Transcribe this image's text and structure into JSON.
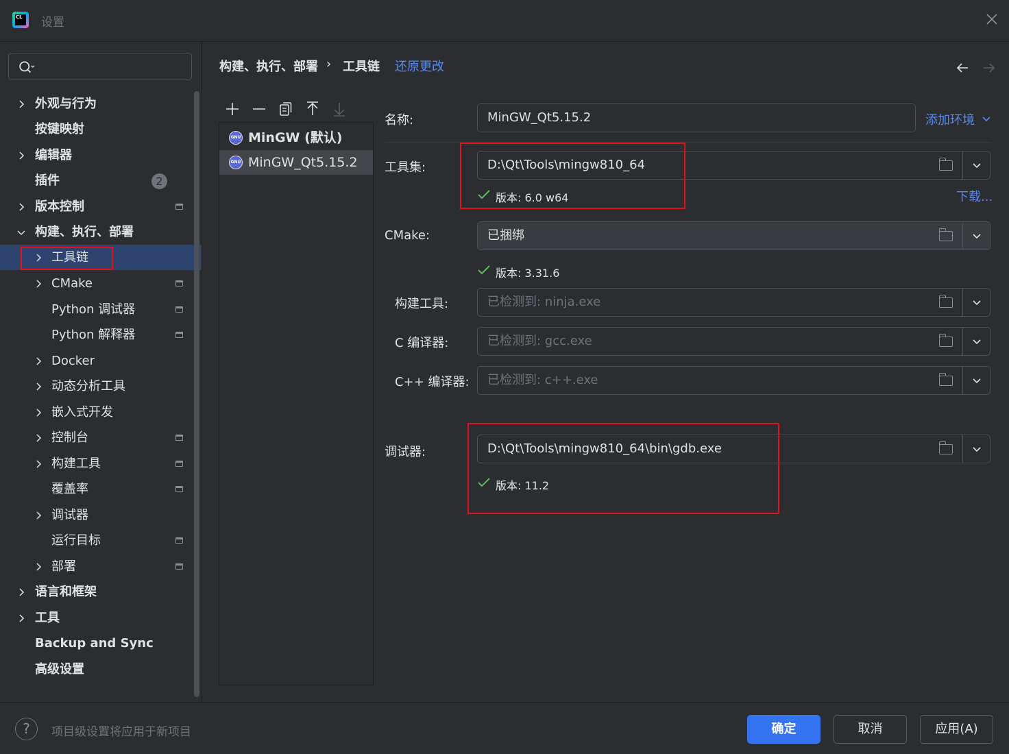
{
  "window": {
    "title": "设置",
    "logo_text": "CL"
  },
  "sidebar": {
    "search_placeholder": "",
    "items": [
      {
        "label": "外观与行为",
        "bold": true
      },
      {
        "label": "按键映射",
        "bold": true
      },
      {
        "label": "编辑器",
        "bold": true
      },
      {
        "label": "插件",
        "bold": true,
        "badge": "2"
      },
      {
        "label": "版本控制",
        "bold": true
      },
      {
        "label": "构建、执行、部署",
        "bold": true
      },
      {
        "label": "工具链"
      },
      {
        "label": "CMake"
      },
      {
        "label": "Python 调试器"
      },
      {
        "label": "Python 解释器"
      },
      {
        "label": "Docker"
      },
      {
        "label": "动态分析工具"
      },
      {
        "label": "嵌入式开发"
      },
      {
        "label": "控制台"
      },
      {
        "label": "构建工具"
      },
      {
        "label": "覆盖率"
      },
      {
        "label": "调试器"
      },
      {
        "label": "运行目标"
      },
      {
        "label": "部署"
      },
      {
        "label": "语言和框架",
        "bold": true
      },
      {
        "label": "工具",
        "bold": true
      },
      {
        "label": "Backup and Sync",
        "bold": true
      },
      {
        "label": "高级设置",
        "bold": true
      }
    ]
  },
  "breadcrumb": {
    "parent": "构建、执行、部署",
    "separator": "›",
    "current": "工具链",
    "reset_link": "还原更改"
  },
  "toolchains": {
    "items": [
      {
        "name": "MinGW (默认)",
        "icon": "GNU"
      },
      {
        "name": "MinGW_Qt5.15.2",
        "icon": "GNU"
      }
    ]
  },
  "form": {
    "name_label": "名称:",
    "name_value": "MinGW_Qt5.15.2",
    "add_env_label": "添加环境",
    "toolset_label": "工具集:",
    "toolset_value": "D:\\Qt\\Tools\\mingw810_64",
    "toolset_version": "版本: 6.0 w64",
    "download_link": "下载...",
    "cmake_label": "CMake:",
    "cmake_value": "已捆绑",
    "cmake_version": "版本: 3.31.6",
    "build_tool_label": "构建工具:",
    "build_tool_placeholder": "已检测到: ninja.exe",
    "c_compiler_label": "C 编译器:",
    "c_compiler_placeholder": "已检测到: gcc.exe",
    "cpp_compiler_label": "C++ 编译器:",
    "cpp_compiler_placeholder": "已检测到: c++.exe",
    "debugger_label": "调试器:",
    "debugger_value": "D:\\Qt\\Tools\\mingw810_64\\bin\\gdb.exe",
    "debugger_version": "版本: 11.2"
  },
  "footer": {
    "help_icon": "?",
    "hint": "项目级设置将应用于新项目",
    "ok_label": "确定",
    "cancel_label": "取消",
    "apply_label": "应用(A)"
  },
  "colors": {
    "accent": "#3574f0",
    "link": "#548af7",
    "selection": "#2e436e",
    "highlight_box": "#e0121b",
    "check": "#5fb865"
  }
}
